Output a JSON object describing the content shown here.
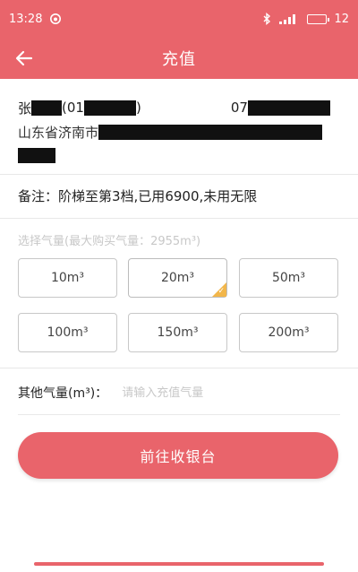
{
  "statusbar": {
    "time": "13:28",
    "app_icon": "weibo-icon",
    "signal_text": "ııl",
    "battery_level": "12",
    "bluetooth_icon": "bluetooth-icon"
  },
  "appbar": {
    "title": "充值",
    "back_icon": "back-arrow-icon"
  },
  "account": {
    "name_prefix": "张",
    "id_prefix": "(01",
    "id_suffix": ")",
    "phone_prefix": "07",
    "address_prefix": "山东省济南市"
  },
  "note": "备注：阶梯至第3档,已用6900,未用无限",
  "hint": "选择气量(最大购买气量：2955m³)",
  "options": [
    {
      "label": "10m³",
      "selected": false
    },
    {
      "label": "20m³",
      "selected": true
    },
    {
      "label": "50m³",
      "selected": false
    },
    {
      "label": "100m³",
      "selected": false
    },
    {
      "label": "150m³",
      "selected": false
    },
    {
      "label": "200m³",
      "selected": false
    }
  ],
  "other": {
    "label": "其他气量(m³)：",
    "placeholder": "请输入充值气量",
    "value": ""
  },
  "pay_button": "前往收银台",
  "colors": {
    "accent": "#e9646b",
    "selected_badge": "#f2b64a"
  }
}
